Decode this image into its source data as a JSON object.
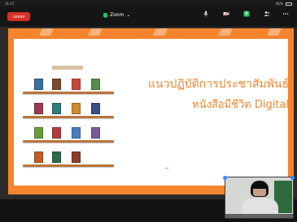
{
  "status_bar": {
    "time": "11:17",
    "date": "",
    "battery": "61%"
  },
  "topbar": {
    "leave_label": "Leave",
    "app_name": "Zoom",
    "app_subtitle": "",
    "actions": [
      {
        "icon": "mic-icon",
        "label": ""
      },
      {
        "icon": "video-icon",
        "label": ""
      },
      {
        "icon": "share-icon",
        "label": ""
      },
      {
        "icon": "participants-icon",
        "label": ""
      },
      {
        "icon": "more-icon",
        "label": ""
      }
    ]
  },
  "slide": {
    "headline_line1": "แนวปฏิบัติการประชาสัมพันธ์",
    "headline_line2": "หนังสือมีชีวิต Digital",
    "caption": ""
  },
  "self_view": {
    "name": ""
  },
  "colors": {
    "accent_orange": "#f4842d",
    "leave_red": "#d93025",
    "zoom_blue": "#2d8cff"
  }
}
